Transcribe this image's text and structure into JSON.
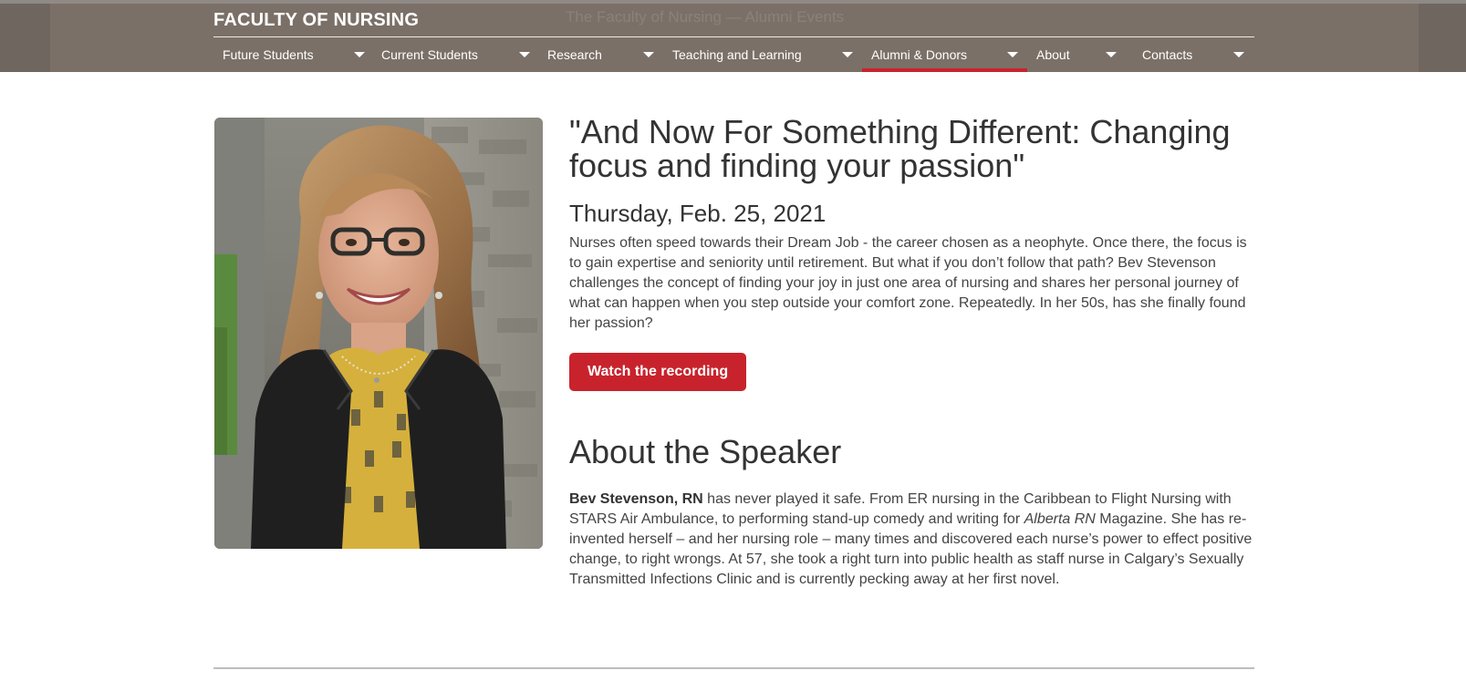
{
  "header": {
    "faculty_title": "FACULTY OF NURSING",
    "faded_text": "The Faculty of Nursing — Alumni Events"
  },
  "nav": {
    "items": [
      {
        "label": "Future Students"
      },
      {
        "label": "Current Students"
      },
      {
        "label": "Research"
      },
      {
        "label": "Teaching and Learning"
      },
      {
        "label": "Alumni & Donors",
        "active": true
      },
      {
        "label": "About"
      },
      {
        "label": "Contacts"
      }
    ],
    "active_color": "#c8232c"
  },
  "event": {
    "title": "\"And Now For Something Different: Changing focus and finding your passion\"",
    "date": "Thursday, Feb. 25, 2021",
    "description": "Nurses often speed towards their Dream Job - the career chosen as a neophyte. Once there, the focus is to gain expertise and seniority until retirement. But what if you don’t follow that path? Bev Stevenson challenges the concept of finding your joy in just one area of nursing and shares her personal journey of what can happen when you step outside your comfort zone. Repeatedly. In her 50s, has she finally found her passion?",
    "button_label": "Watch the recording",
    "button_color": "#c8232c"
  },
  "speaker": {
    "heading": "About the Speaker",
    "name": "Bev Stevenson, RN",
    "bio_part1": " has never played it safe. From ER nursing in the Caribbean to Flight Nursing with STARS Air Ambulance, to performing stand-up comedy and writing for ",
    "publication": "Alberta RN",
    "bio_part2": " Magazine. She has re-invented herself – and her nursing role – many times and discovered each nurse’s power to effect positive change, to right wrongs. At 57, she took a right turn into public health as staff nurse in Calgary’s Sexually Transmitted Infections Clinic and is currently pecking away at her first novel.",
    "photo_icon": "speaker-portrait"
  },
  "colors": {
    "header_bg": "#6f665f",
    "accent": "#c8232c"
  }
}
